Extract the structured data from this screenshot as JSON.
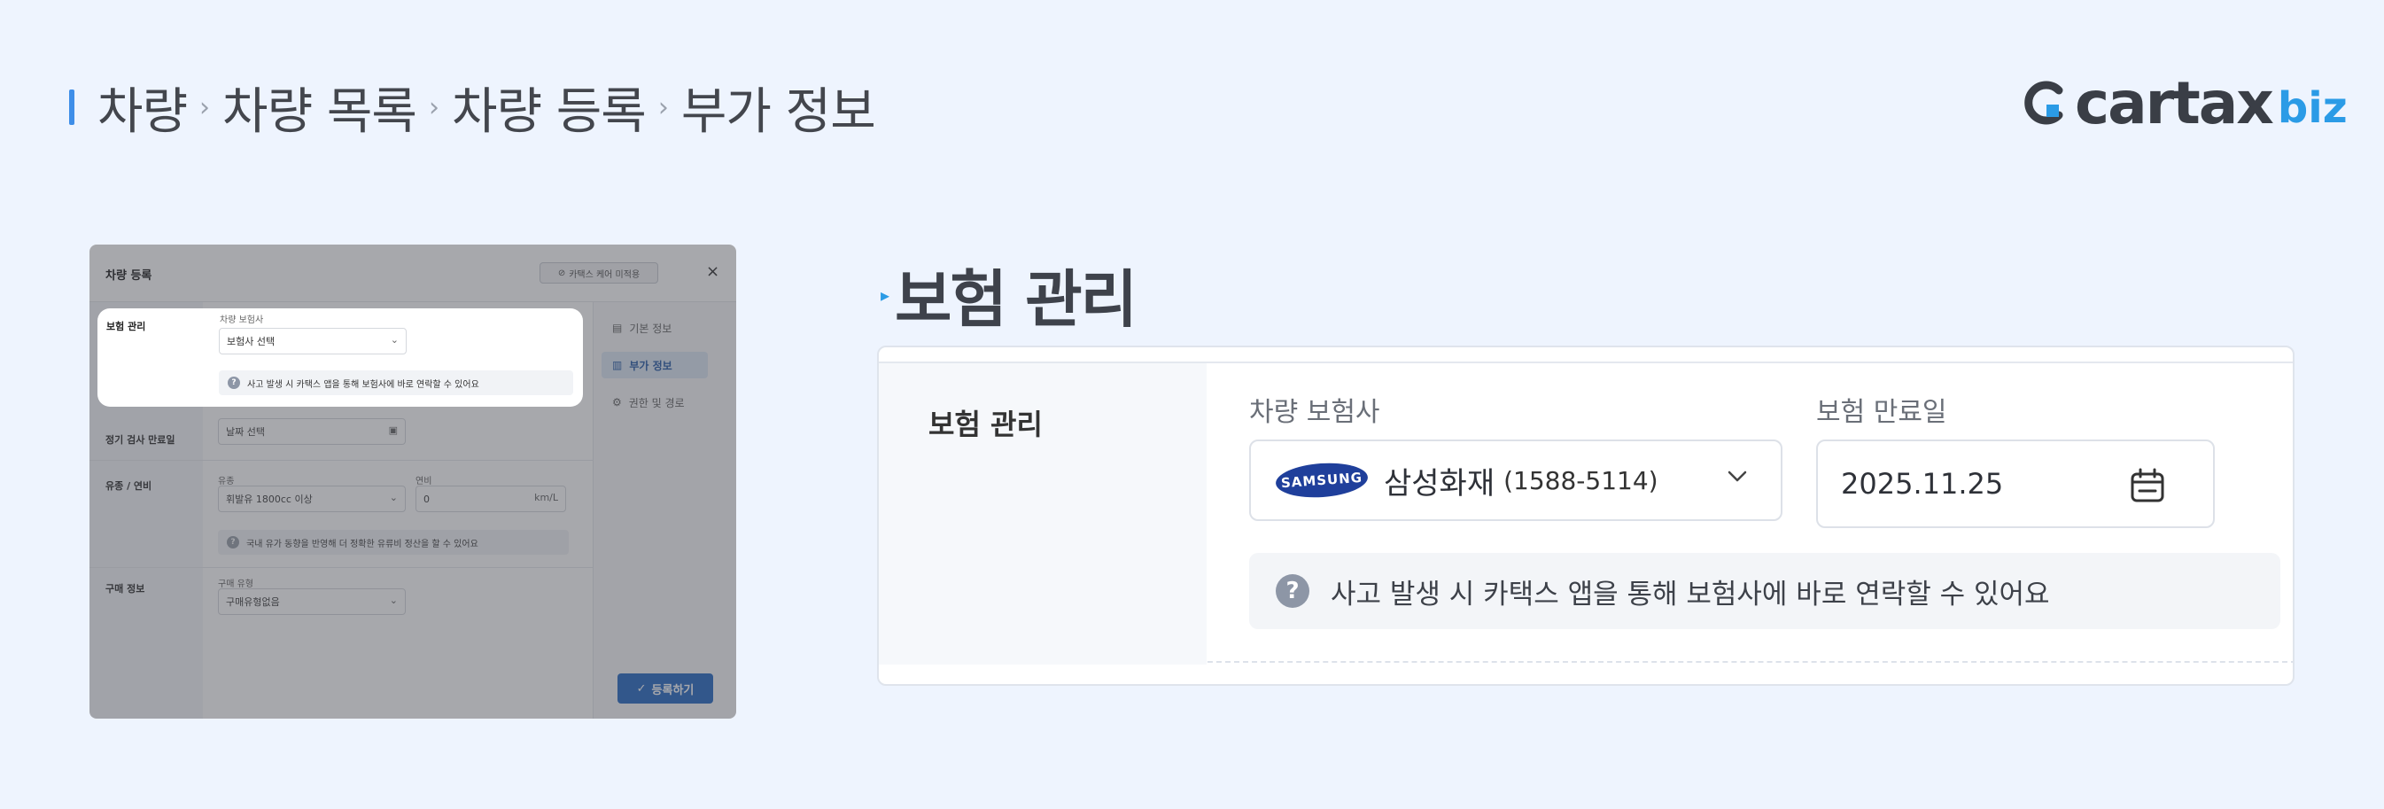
{
  "breadcrumb": {
    "items": [
      "차량",
      "차량 목록",
      "차량 등록",
      "부가 정보"
    ],
    "separator": "›"
  },
  "logo": {
    "main": "cartax",
    "suffix": "biz",
    "accent_color": "#2b9be6"
  },
  "modal": {
    "title": "차량 등록",
    "badge": "카택스 케어 미적용",
    "close_symbol": "×",
    "rows": {
      "insurance": {
        "label": "보험 관리",
        "field_label": "차량 보험사",
        "select_value": "보험사 선택",
        "info": "사고 발생 시 카택스 앱을 통해 보험사에 바로 연락할 수 있어요"
      },
      "inspection": {
        "label": "정기 검사 만료일",
        "date_placeholder": "날짜 선택"
      },
      "fuel": {
        "label": "유종 / 연비",
        "fuel_label": "유종",
        "fuel_value": "휘발유 1800cc 이상",
        "efficiency_label": "연비",
        "efficiency_value": "0",
        "efficiency_unit": "km/L",
        "info": "국내 유가 동향을 반영해 더 정확한 유류비 정산을 할 수 있어요"
      },
      "purchase": {
        "label": "구매 정보",
        "type_label": "구매 유형",
        "type_value": "구매유형없음"
      }
    },
    "nav": [
      {
        "label": "기본 정보",
        "active": false
      },
      {
        "label": "부가 정보",
        "active": true
      },
      {
        "label": "권한 및 경로",
        "active": false
      }
    ],
    "submit_label": "등록하기"
  },
  "section": {
    "title": "보험 관리"
  },
  "card": {
    "row_label": "보험 관리",
    "insurer_label": "차량 보험사",
    "insurer_logo": "SAMSUNG",
    "insurer_name": "삼성화재",
    "insurer_phone": "(1588-5114)",
    "expiry_label": "보험 만료일",
    "expiry_value": "2025.11.25",
    "info": "사고 발생 시 카택스 앱을 통해 보험사에 바로 연락할 수 있어요",
    "info_icon": "?"
  }
}
